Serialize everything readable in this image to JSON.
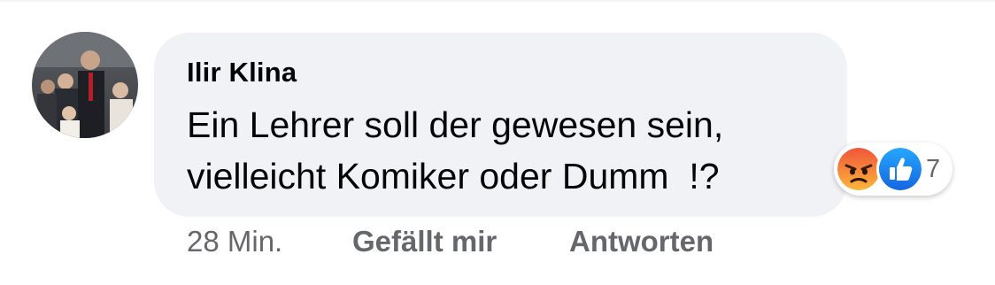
{
  "comment": {
    "author": "Ilir Klina",
    "text_lines": [
      "Ein Lehrer soll der gewesen sein,",
      "vielleicht Komiker oder Dumm  !?"
    ],
    "timestamp": "28 Min.",
    "actions": {
      "like_label": "Gefällt mir",
      "reply_label": "Antworten"
    },
    "reactions": {
      "icons": [
        "angry-face-icon",
        "thumbs-up-icon"
      ],
      "count": "7"
    }
  },
  "colors": {
    "bubble_bg": "#f0f2f5",
    "text": "#050505",
    "secondary_text": "#65676b",
    "like_blue": "#1877f2",
    "angry_orange": "#e9710f"
  }
}
